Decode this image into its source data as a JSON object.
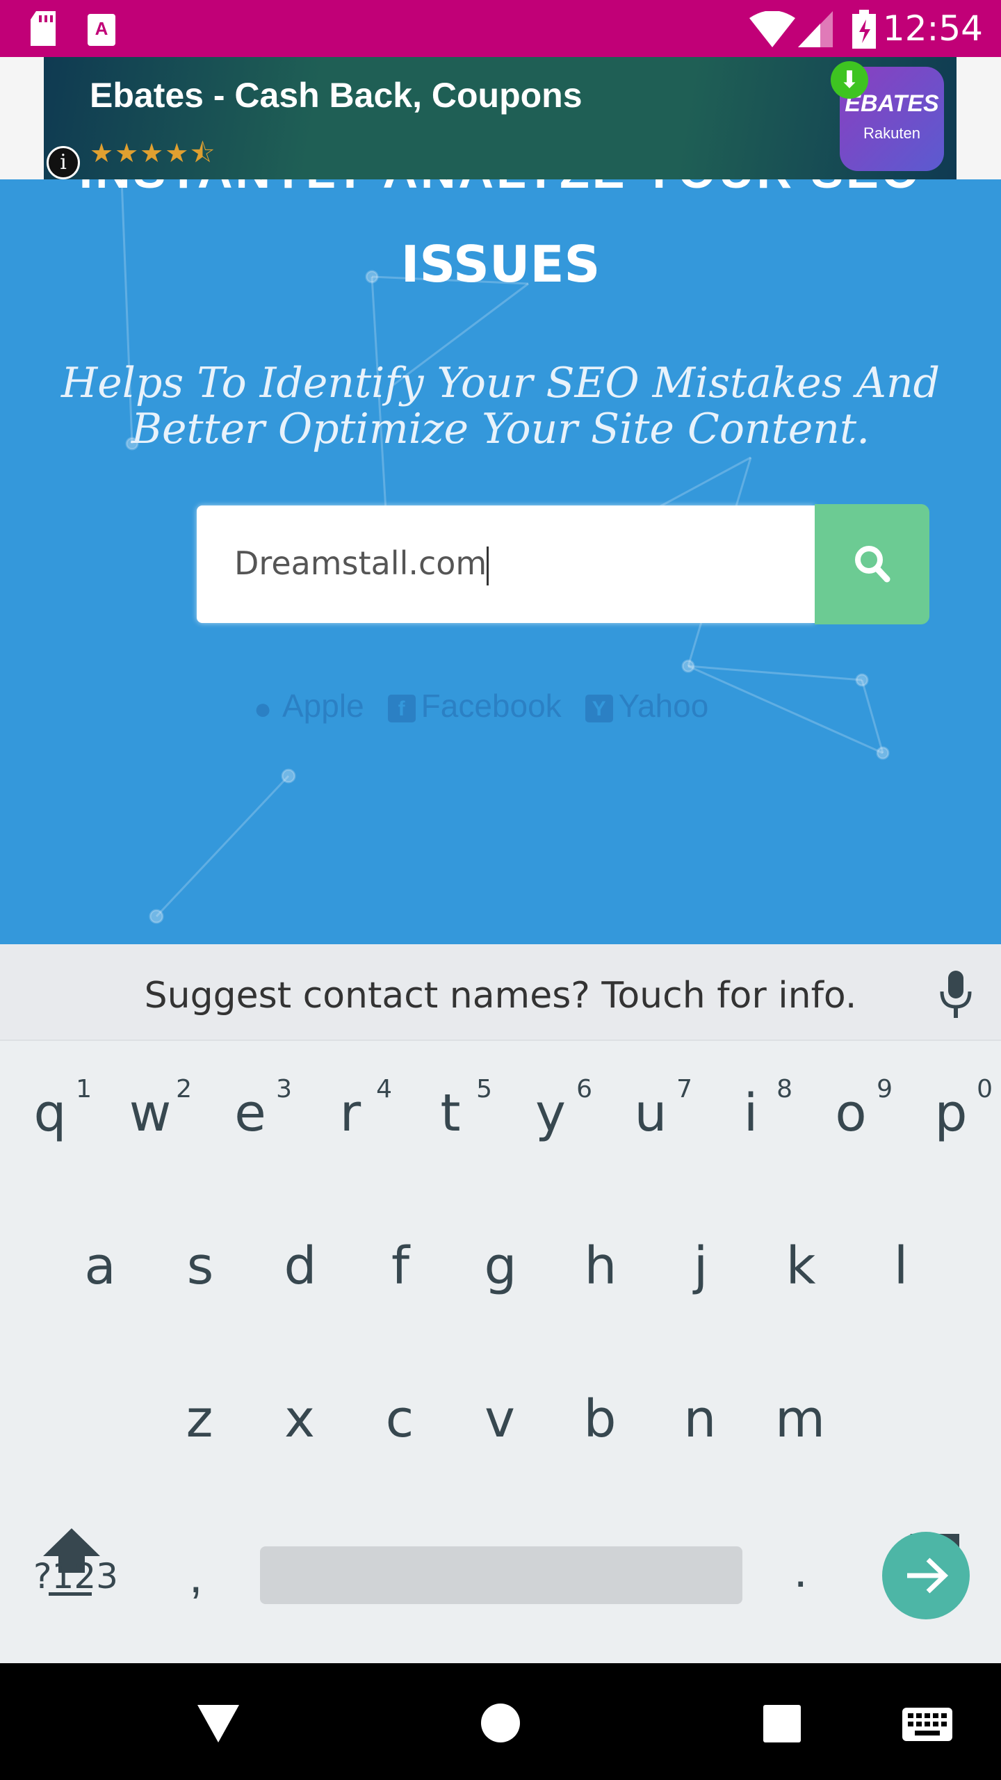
{
  "status_bar": {
    "time": "12:54",
    "icons": [
      "sd-card-icon",
      "a-notification-icon",
      "wifi-icon",
      "signal-icon",
      "battery-charging-icon"
    ]
  },
  "ad": {
    "title": "Ebates - Cash Back, Coupons",
    "rating": 4.5,
    "stars": "★★★★⯪",
    "info": "i",
    "logo_text": "EBATES",
    "logo_sub": "Rakuten"
  },
  "hero": {
    "title_cut": "INSTANTLY ANALYZE YOUR SEO",
    "title": "ISSUES",
    "subtitle_1": "Helps To Identify Your SEO Mistakes And",
    "subtitle_2": "Better Optimize Your Site Content.",
    "search_value": "Dreamstall.com",
    "examples": [
      "Apple",
      "Facebook",
      "Yahoo"
    ],
    "colors": {
      "bg": "#3498db",
      "button": "#6ccb93"
    }
  },
  "keyboard": {
    "suggestion": "Suggest contact names? Touch for info.",
    "row1": [
      "q",
      "w",
      "e",
      "r",
      "t",
      "y",
      "u",
      "i",
      "o",
      "p"
    ],
    "row1_hints": [
      "1",
      "2",
      "3",
      "4",
      "5",
      "6",
      "7",
      "8",
      "9",
      "0"
    ],
    "row2": [
      "a",
      "s",
      "d",
      "f",
      "g",
      "h",
      "j",
      "k",
      "l"
    ],
    "row3": [
      "z",
      "x",
      "c",
      "v",
      "b",
      "n",
      "m"
    ],
    "symbols": "?123",
    "comma": ",",
    "period": "."
  }
}
